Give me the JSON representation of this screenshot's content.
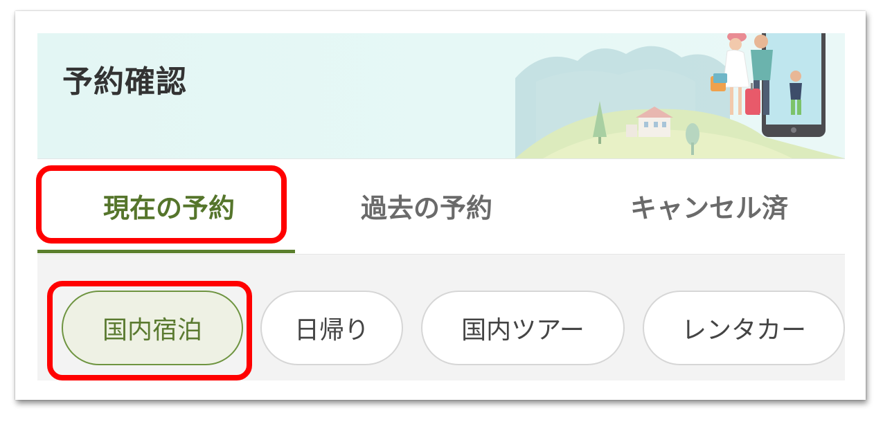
{
  "header": {
    "title": "予約確認"
  },
  "tabs": [
    {
      "label": "現在の予約",
      "active": true
    },
    {
      "label": "過去の予約",
      "active": false
    },
    {
      "label": "キャンセル済",
      "active": false
    }
  ],
  "categories": [
    {
      "label": "国内宿泊",
      "active": true
    },
    {
      "label": "日帰り",
      "active": false
    },
    {
      "label": "国内ツアー",
      "active": false
    },
    {
      "label": "レンタカー",
      "active": false
    }
  ],
  "colors": {
    "accent": "#5b7f2d",
    "highlight": "#ff0000",
    "header_bg": "#e3f6f4",
    "chip_area_bg": "#f3f3f3"
  }
}
